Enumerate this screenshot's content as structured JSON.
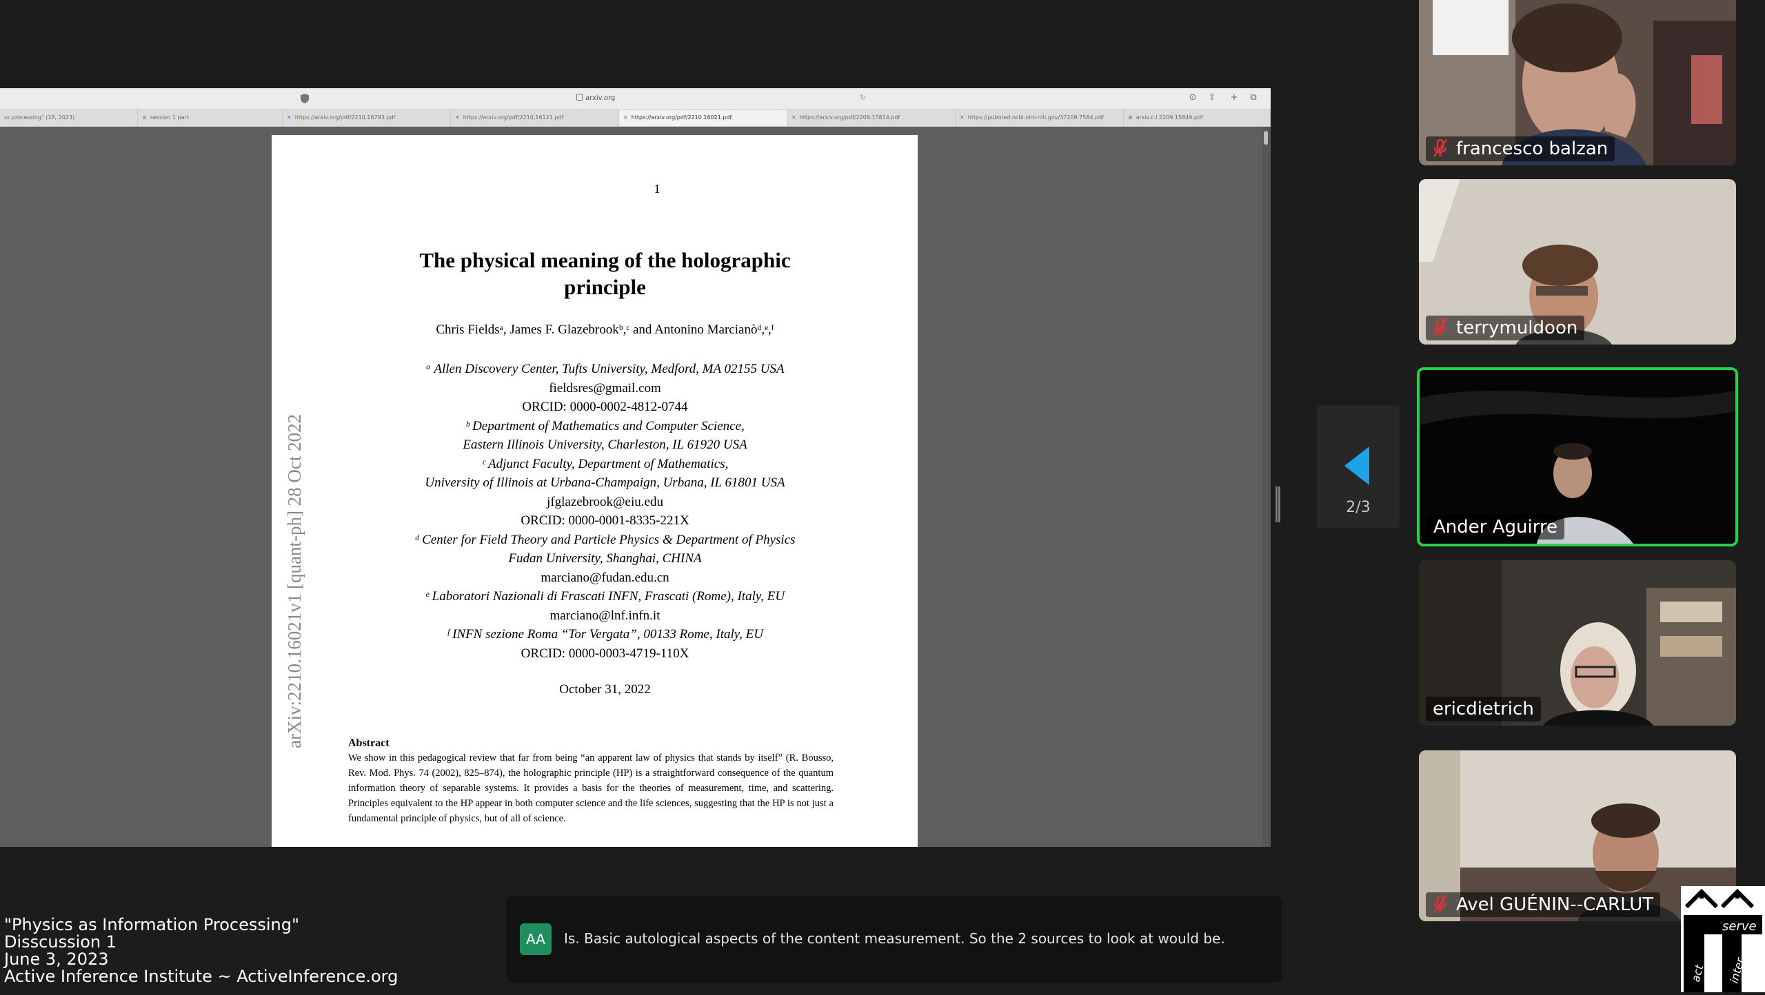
{
  "browser": {
    "address": "arxiv.org",
    "tabs": [
      {
        "label": "ss processing\" (18, 2023)",
        "active": false
      },
      {
        "label": "session 1 part",
        "active": false
      },
      {
        "label": "https://arxiv.org/pdf/2210.16793.pdf",
        "active": false
      },
      {
        "label": "https://arxiv.org/pdf/2210.16121.pdf",
        "active": false
      },
      {
        "label": "https://arxiv.org/pdf/2210.16021.pdf",
        "active": true
      },
      {
        "label": "https://arxiv.org/pdf/2209.15814.pdf",
        "active": false
      },
      {
        "label": "https://pubmed.ncbi.nlm.nih.gov/37209.7584.pdf",
        "active": false
      },
      {
        "label": "arxiv.c.l 2209.15849.pdf",
        "active": false
      }
    ]
  },
  "pdf": {
    "page_number": "1",
    "title_line1": "The physical meaning of the holographic",
    "title_line2": "principle",
    "authors": "Chris Fieldsᵃ, James F. Glazebrookᵇ,ᶜ and Antonino Marcianòᵈ,ᵉ,ᶠ",
    "affiliations": [
      {
        "text": "ᵃ Allen Discovery Center, Tufts University, Medford, MA 02155 USA",
        "italic": true
      },
      {
        "text": "fieldsres@gmail.com",
        "italic": false
      },
      {
        "text": "ORCID: 0000-0002-4812-0744",
        "italic": false
      },
      {
        "text": "ᵇ Department of Mathematics and Computer Science,",
        "italic": true
      },
      {
        "text": "Eastern Illinois University, Charleston, IL 61920 USA",
        "italic": true
      },
      {
        "text": "ᶜ Adjunct Faculty, Department of Mathematics,",
        "italic": true
      },
      {
        "text": "University of Illinois at Urbana-Champaign, Urbana, IL 61801 USA",
        "italic": true
      },
      {
        "text": "jfglazebrook@eiu.edu",
        "italic": false
      },
      {
        "text": "ORCID: 0000-0001-8335-221X",
        "italic": false
      },
      {
        "text": "ᵈ Center for Field Theory and Particle Physics & Department of Physics",
        "italic": true
      },
      {
        "text": "Fudan University, Shanghai, CHINA",
        "italic": true
      },
      {
        "text": "marciano@fudan.edu.cn",
        "italic": false
      },
      {
        "text": "ᵉ Laboratori Nazionali di Frascati INFN, Frascati (Rome), Italy, EU",
        "italic": true
      },
      {
        "text": "marciano@lnf.infn.it",
        "italic": false
      },
      {
        "text": "ᶠ INFN sezione Roma “Tor Vergata”, 00133 Rome, Italy, EU",
        "italic": true
      },
      {
        "text": "ORCID: 0000-0003-4719-110X",
        "italic": false
      }
    ],
    "date": "October 31, 2022",
    "abstract_heading": "Abstract",
    "abstract_text": "We show in this pedagogical review that far from being “an apparent law of physics that stands by itself” (R. Bousso, Rev. Mod. Phys. 74 (2002), 825–874), the holographic principle (HP) is a straightforward consequence of the quantum information theory of separable systems. It provides a basis for the theories of measurement, time, and scattering. Principles equivalent to the HP appear in both computer science and the life sciences, suggesting that the HP is not just a fundamental principle of physics, but of all of science.",
    "arxiv_stamp": "arXiv:2210.16021v1  [quant-ph]  28 Oct 2022"
  },
  "gallery": {
    "pager": "2/3",
    "participants": [
      {
        "name": "francesco balzan",
        "muted": true,
        "speaking": false
      },
      {
        "name": "terrymuldoon",
        "muted": true,
        "speaking": false
      },
      {
        "name": "Ander Aguirre",
        "muted": false,
        "speaking": true
      },
      {
        "name": "ericdietrich",
        "muted": false,
        "speaking": false
      },
      {
        "name": "Avel GUÉNIN--CARLUT",
        "muted": true,
        "speaking": false
      }
    ]
  },
  "caption": {
    "initials": "AA",
    "text": "Is. Basic autological aspects of the content measurement. So the 2 sources to look at would be."
  },
  "overlay": {
    "line1": "\"Physics as Information Processing\"",
    "line2": "Disscussion 1",
    "line3": "June 3, 2023",
    "line4": "Active Inference Institute ~ ActiveInference.org"
  },
  "logo": {
    "text_top": "serve",
    "text_left": "act",
    "text_right": "inter"
  },
  "colors": {
    "speaker_border": "#2bd048",
    "pager_arrow": "#1fa3e8",
    "mute_red": "#e0323b"
  }
}
